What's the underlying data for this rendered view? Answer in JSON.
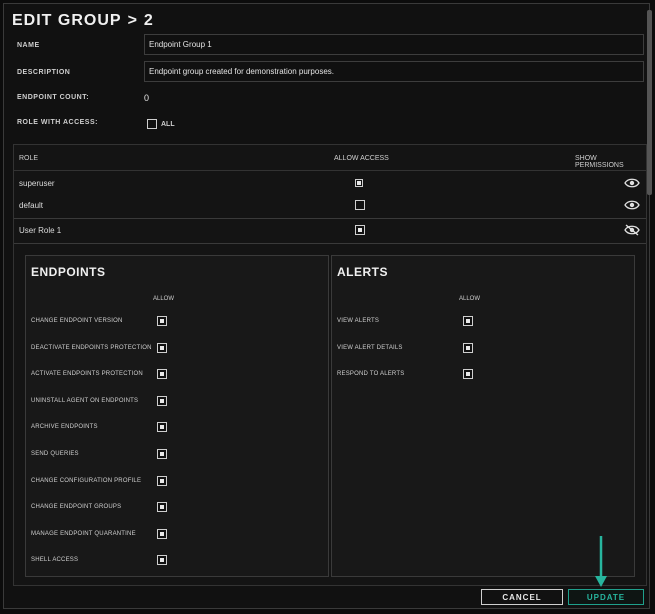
{
  "dialog": {
    "title": "EDIT GROUP",
    "title_sep": ">",
    "title_count": "2"
  },
  "form": {
    "name_label": "NAME",
    "name_value": "Endpoint Group 1",
    "description_label": "DESCRIPTION",
    "description_value": "Endpoint group created for demonstration purposes.",
    "endpoint_count_label": "ENDPOINT COUNT:",
    "endpoint_count_value": "0",
    "role_access_label": "ROLE WITH ACCESS:",
    "all_label": "ALL",
    "all_checked": false
  },
  "roles_table": {
    "headers": {
      "role": "ROLE",
      "allow_access": "ALLOW ACCESS",
      "show_permissions": "SHOW PERMISSIONS"
    },
    "rows": [
      {
        "name": "superuser",
        "checked": true,
        "eye": "eye-icon"
      },
      {
        "name": "default",
        "checked": false,
        "eye": "eye-icon"
      },
      {
        "name": "User Role 1",
        "checked": true,
        "eye": "eye-off-icon"
      }
    ]
  },
  "endpoints_panel": {
    "title": "ENDPOINTS",
    "allow_header": "ALLOW",
    "items": [
      {
        "label": "CHANGE ENDPOINT VERSION",
        "checked": true
      },
      {
        "label": "DEACTIVATE ENDPOINTS PROTECTION",
        "checked": true
      },
      {
        "label": "ACTIVATE ENDPOINTS PROTECTION",
        "checked": true
      },
      {
        "label": "UNINSTALL AGENT ON ENDPOINTS",
        "checked": true
      },
      {
        "label": "ARCHIVE ENDPOINTS",
        "checked": true
      },
      {
        "label": "SEND QUERIES",
        "checked": true
      },
      {
        "label": "CHANGE CONFIGURATION PROFILE",
        "checked": true
      },
      {
        "label": "CHANGE ENDPOINT GROUPS",
        "checked": true
      },
      {
        "label": "MANAGE ENDPOINT QUARANTINE",
        "checked": true
      },
      {
        "label": "SHELL ACCESS",
        "checked": true
      }
    ]
  },
  "alerts_panel": {
    "title": "ALERTS",
    "allow_header": "ALLOW",
    "items": [
      {
        "label": "VIEW ALERTS",
        "checked": true
      },
      {
        "label": "VIEW ALERT DETAILS",
        "checked": true
      },
      {
        "label": "RESPOND TO ALERTS",
        "checked": true
      }
    ]
  },
  "buttons": {
    "cancel": "CANCEL",
    "update": "UPDATE"
  },
  "colors": {
    "accent": "#27b59e",
    "background": "#111111"
  }
}
